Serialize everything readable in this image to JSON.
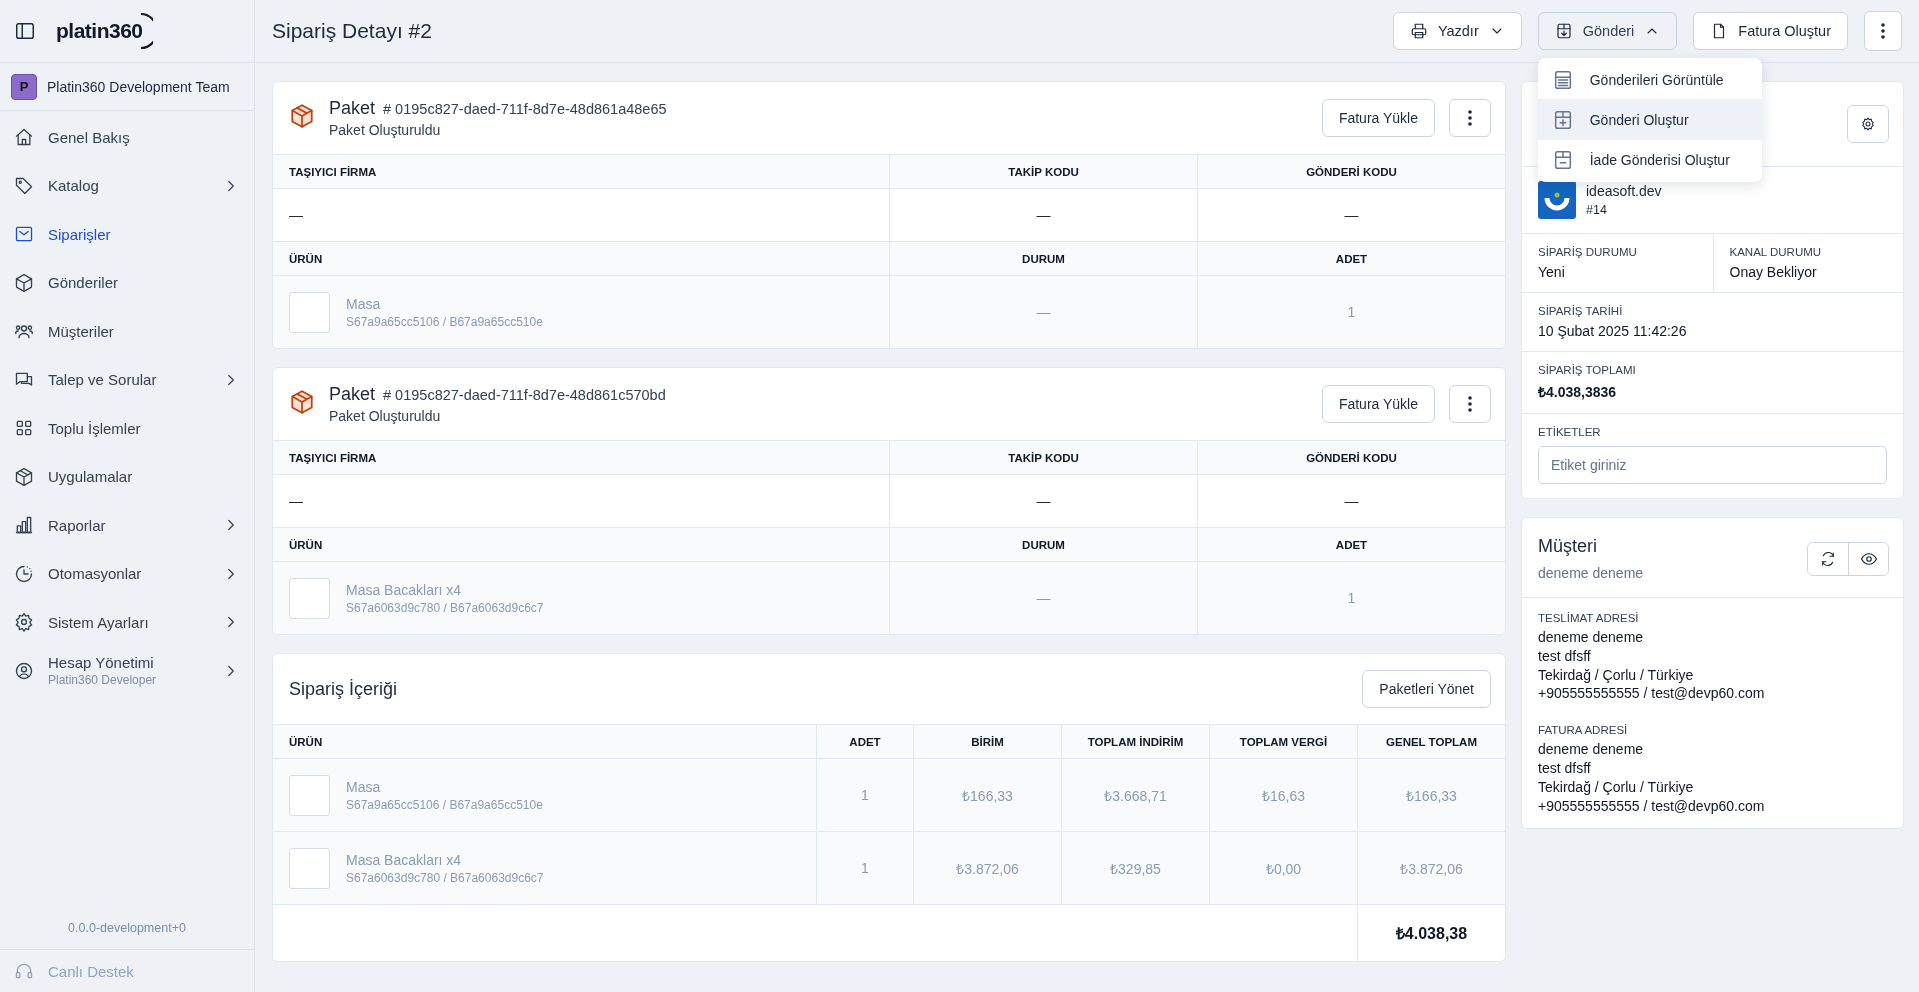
{
  "sidebar": {
    "brand": "platin360",
    "team": {
      "initial": "P",
      "name": "Platin360 Development Team"
    },
    "items": [
      {
        "label": "Genel Bakış",
        "selected": false,
        "expandable": false
      },
      {
        "label": "Katalog",
        "selected": false,
        "expandable": true
      },
      {
        "label": "Siparişler",
        "selected": true,
        "expandable": false
      },
      {
        "label": "Gönderiler",
        "selected": false,
        "expandable": false
      },
      {
        "label": "Müşteriler",
        "selected": false,
        "expandable": false
      },
      {
        "label": "Talep ve Sorular",
        "selected": false,
        "expandable": true
      },
      {
        "label": "Toplu İşlemler",
        "selected": false,
        "expandable": false
      },
      {
        "label": "Uygulamalar",
        "selected": false,
        "expandable": false
      },
      {
        "label": "Raporlar",
        "selected": false,
        "expandable": true
      },
      {
        "label": "Otomasyonlar",
        "selected": false,
        "expandable": true
      },
      {
        "label": "Sistem Ayarları",
        "selected": false,
        "expandable": true
      },
      {
        "label": "Hesap Yönetimi",
        "subtitle": "Platin360 Developer",
        "selected": false,
        "expandable": true
      }
    ],
    "version": "0.0.0-development+0",
    "support": "Canlı Destek"
  },
  "header": {
    "title": "Sipariş Detayı #2",
    "actions": [
      {
        "label": "Yazdır",
        "kind": "dropdown",
        "expanded": false
      },
      {
        "label": "Gönderi",
        "kind": "dropdown",
        "expanded": true
      },
      {
        "label": "Fatura Oluştur",
        "kind": "button"
      },
      {
        "kind": "more"
      }
    ],
    "menu": [
      {
        "label": "Gönderileri Görüntüle",
        "selected": false
      },
      {
        "label": "Gönderi Oluştur",
        "selected": true
      },
      {
        "label": "İade Gönderisi Oluştur",
        "selected": false
      }
    ]
  },
  "packages": [
    {
      "title": "Paket",
      "code": "# 0195c827-daed-711f-8d7e-48d861a48e65",
      "status": "Paket Oluşturuldu",
      "button": "Fatura Yükle",
      "shipping_columns": [
        "TAŞIYICI FİRMA",
        "TAKİP KODU",
        "GÖNDERİ KODU"
      ],
      "shipping_row": [
        "—",
        "—",
        "—"
      ],
      "product_columns": [
        "ÜRÜN",
        "DURUM",
        "ADET"
      ],
      "products": [
        {
          "name": "Masa",
          "sku": "S67a9a65cc5106 / B67a9a65cc510e",
          "status": "—",
          "quantity": "1"
        }
      ]
    },
    {
      "title": "Paket",
      "code": "# 0195c827-daed-711f-8d7e-48d861c570bd",
      "status": "Paket Oluşturuldu",
      "button": "Fatura Yükle",
      "shipping_columns": [
        "TAŞIYICI FİRMA",
        "TAKİP KODU",
        "GÖNDERİ KODU"
      ],
      "shipping_row": [
        "—",
        "—",
        "—"
      ],
      "product_columns": [
        "ÜRÜN",
        "DURUM",
        "ADET"
      ],
      "products": [
        {
          "name": "Masa Bacakları x4",
          "sku": "S67a6063d9c780 / B67a6063d9c6c7",
          "status": "—",
          "quantity": "1"
        }
      ]
    }
  ],
  "order_contents": {
    "title": "Sipariş İçeriği",
    "button": "Paketleri Yönet",
    "columns": [
      "ÜRÜN",
      "ADET",
      "BİRİM",
      "TOPLAM İNDİRİM",
      "TOPLAM VERGİ",
      "GENEL TOPLAM"
    ],
    "rows": [
      {
        "product": {
          "name": "Masa",
          "sku": "S67a9a65cc5106 / B67a9a65cc510e"
        },
        "quantity": "1",
        "unit_price": "₺166,33",
        "total_discount": "₺3.668,71",
        "total_tax": "₺16,63",
        "grand_total": "₺166,33"
      },
      {
        "product": {
          "name": "Masa Bacakları x4",
          "sku": "S67a6063d9c780 / B67a6063d9c6c7"
        },
        "quantity": "1",
        "unit_price": "₺3.872,06",
        "total_discount": "₺329,85",
        "total_tax": "₺0,00",
        "grand_total": "₺3.872,06"
      }
    ],
    "total": "₺4.038,38"
  },
  "order_panel": {
    "store": {
      "name": "ideasoft.dev",
      "number": "#14"
    },
    "fields": [
      {
        "label": "SİPARİŞ DURUMU",
        "value": "Yeni"
      },
      {
        "label": "KANAL DURUMU",
        "value": "Onay Bekliyor"
      },
      {
        "label": "SİPARİŞ TARİHİ",
        "value": "10 Şubat 2025 11:42:26"
      },
      {
        "label": "SİPARİŞ TOPLAMI",
        "value": "₺4.038,3836"
      }
    ],
    "tags": {
      "label": "ETİKETLER",
      "placeholder": "Etiket giriniz"
    }
  },
  "customer": {
    "title": "Müşteri",
    "name": "deneme deneme",
    "addresses": [
      {
        "label": "TESLİMAT ADRESİ",
        "lines": [
          "deneme deneme",
          "test dfsff",
          "Tekirdağ / Çorlu / Türkiye",
          "+905555555555 / test@devp60.com"
        ]
      },
      {
        "label": "FATURA ADRESİ",
        "lines": [
          "deneme deneme",
          "test dfsff",
          "Tekirdağ / Çorlu / Türkiye",
          "+905555555555 / test@devp60.com"
        ]
      }
    ]
  }
}
